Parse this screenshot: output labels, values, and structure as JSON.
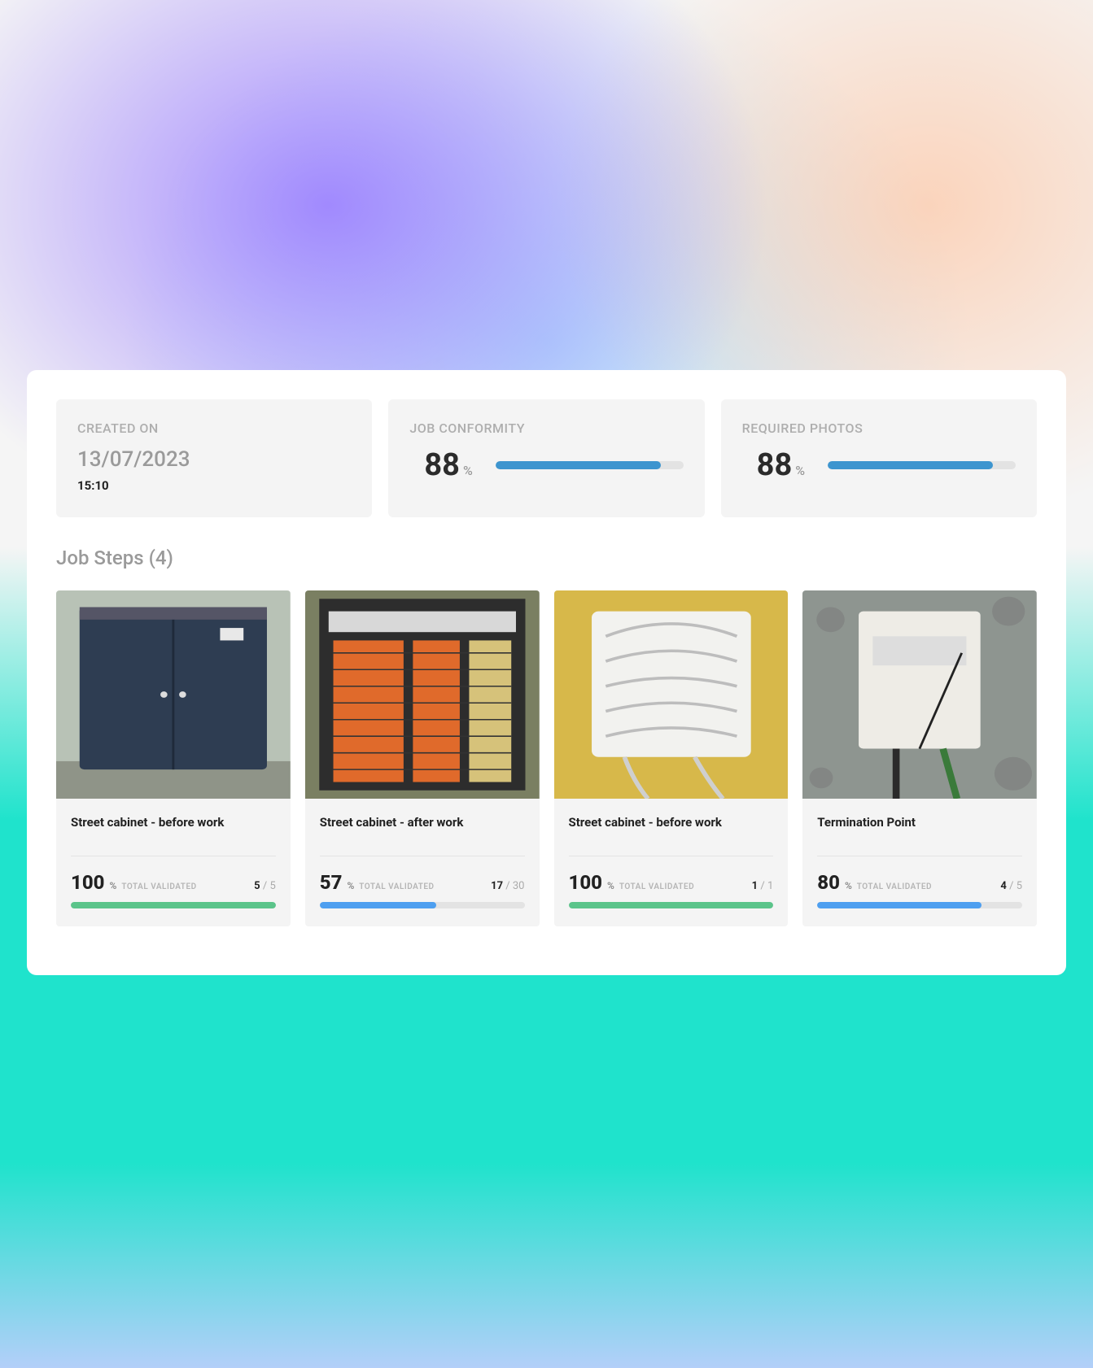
{
  "summary": {
    "created": {
      "label": "CREATED  ON",
      "date": "13/07/2023",
      "time": "15:10"
    },
    "conformity": {
      "label": "JOB CONFORMITY",
      "value": 88,
      "unit": "%"
    },
    "required_photos": {
      "label": "REQUIRED PHOTOS",
      "value": 88,
      "unit": "%"
    }
  },
  "section": {
    "title_prefix": "Job Steps",
    "count": 4
  },
  "steps": [
    {
      "title": "Street cabinet - before work",
      "percent": 100,
      "validated_label": "TOTAL VALIDATED",
      "done": 5,
      "total": 5,
      "color": "green"
    },
    {
      "title": "Street cabinet - after work",
      "percent": 57,
      "validated_label": "TOTAL VALIDATED",
      "done": 17,
      "total": 30,
      "color": "blue"
    },
    {
      "title": "Street cabinet - before work",
      "percent": 100,
      "validated_label": "TOTAL VALIDATED",
      "done": 1,
      "total": 1,
      "color": "green"
    },
    {
      "title": "Termination Point",
      "percent": 80,
      "validated_label": "TOTAL VALIDATED",
      "done": 4,
      "total": 5,
      "color": "blue"
    }
  ]
}
